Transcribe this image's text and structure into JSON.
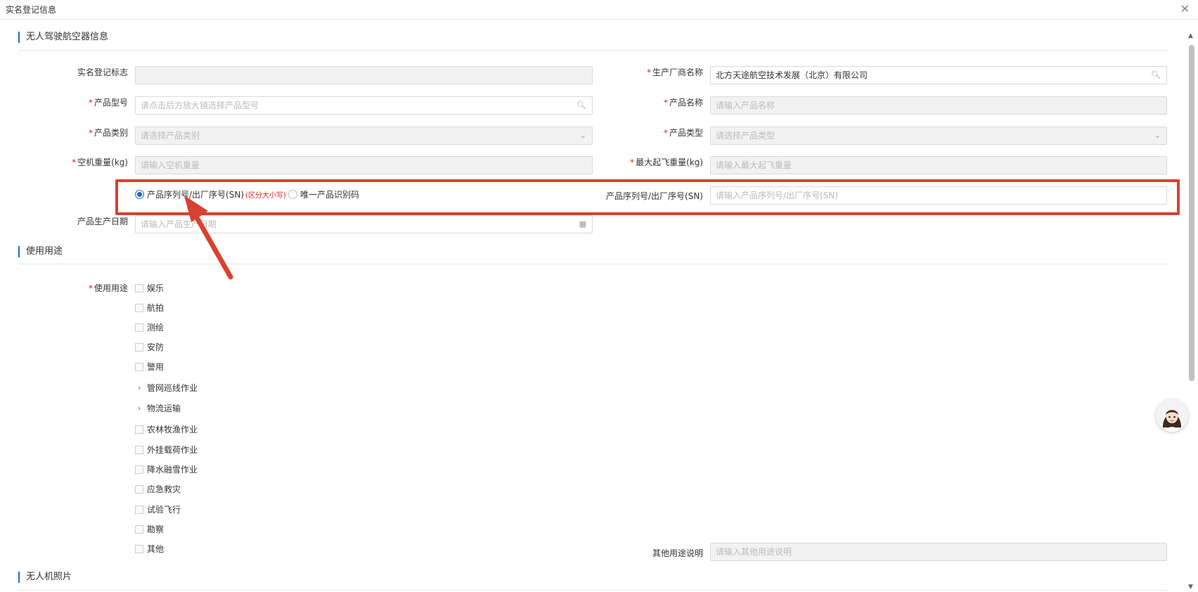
{
  "window": {
    "title": "实名登记信息",
    "close_icon": "close-icon"
  },
  "section1": {
    "title": "无人驾驶航空器信息"
  },
  "fields": {
    "reg_mark": {
      "label": "实名登记标志",
      "value": ""
    },
    "manufacturer": {
      "label": "生产厂商名称",
      "value": "北方天途航空技术发展（北京）有限公司"
    },
    "model": {
      "label": "产品型号",
      "placeholder": "请点击后方放大镜选择产品型号"
    },
    "product_name": {
      "label": "产品名称",
      "placeholder": "请输入产品名称"
    },
    "category": {
      "label": "产品类别",
      "placeholder": "请选择产品类别"
    },
    "product_type": {
      "label": "产品类型",
      "placeholder": "请选择产品类型"
    },
    "empty_weight": {
      "label": "空机重量(kg)",
      "placeholder": "请输入空机重量"
    },
    "max_weight": {
      "label": "最大起飞重量(kg)",
      "placeholder": "请输入最大起飞重量"
    },
    "id_type": {
      "option1": "产品序列号/出厂序号(SN)",
      "option1_hint": "(区分大小写)",
      "option2": "唯一产品识别码",
      "selected": "产品序列号/出厂序号(SN)"
    },
    "serial": {
      "label": "产品序列号/出厂序号(SN)",
      "placeholder": "请输入产品序列号/出厂序号(SN)"
    },
    "prod_date": {
      "label": "产品生产日期",
      "placeholder": "请输入产品生产日期"
    }
  },
  "section2": {
    "title": "使用用途"
  },
  "usage": {
    "label": "使用用途",
    "options": [
      "娱乐",
      "航拍",
      "测绘",
      "安防",
      "警用",
      "管网巡线作业",
      "物流运输",
      "农林牧渔作业",
      "外挂载荷作业",
      "降水融雪作业",
      "应急救灾",
      "试验飞行",
      "勘察",
      "其他"
    ],
    "other_label": "其他用途说明",
    "other_placeholder": "请输入其他用途说明"
  },
  "section3": {
    "title": "无人机照片"
  },
  "colors": {
    "accent": "#1e6fc4",
    "required": "#e02020",
    "highlight": "#d8422f"
  }
}
